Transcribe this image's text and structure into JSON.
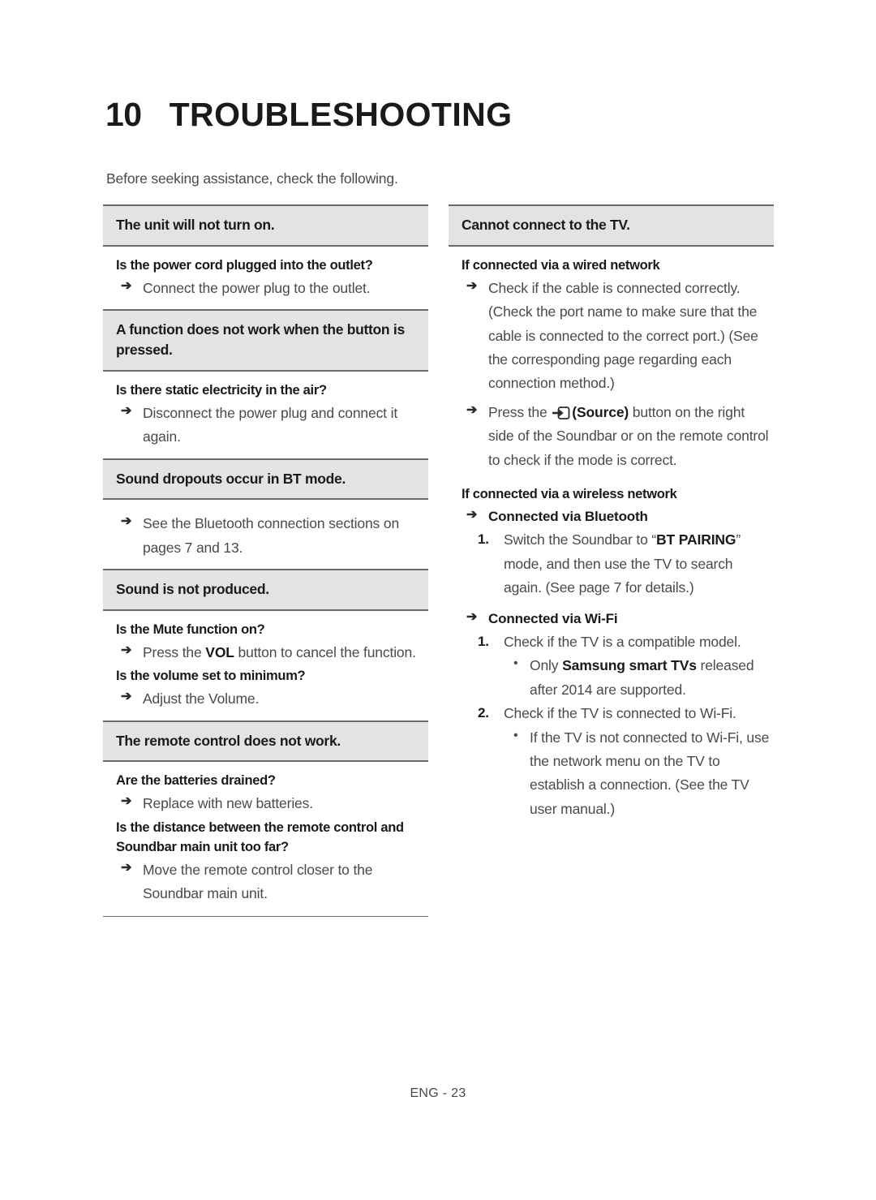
{
  "page": {
    "chapter_number": "10",
    "chapter_title": "TROUBLESHOOTING",
    "intro": "Before seeking assistance, check the following.",
    "footer": "ENG - 23",
    "gray_bar_color": "#e3e3e3",
    "rule_color": "#6a6a6a"
  },
  "left_column": {
    "sections": [
      {
        "heading": "The unit will not turn on.",
        "question": "Is the power cord plugged into the outlet?",
        "answer": "Connect the power plug to the outlet."
      },
      {
        "heading": "A function does not work when the button is pressed.",
        "question": "Is there static electricity in the air?",
        "answer": "Disconnect the power plug and connect it again."
      },
      {
        "heading": "Sound dropouts occur in BT mode.",
        "answer": "See the Bluetooth connection sections on pages 7 and 13."
      },
      {
        "heading": "Sound is not produced.",
        "question": "Is the Mute function on?",
        "answer_pre": "Press the ",
        "answer_bold": "VOL",
        "answer_post": " button to cancel the function.",
        "question2": "Is the volume set to minimum?",
        "answer2": "Adjust the Volume."
      },
      {
        "heading": "The remote control does not work.",
        "question": "Are the batteries drained?",
        "answer": "Replace with new batteries.",
        "question2": "Is the distance between the remote control and Soundbar main unit too far?",
        "answer2": "Move the remote control closer to the Soundbar main unit."
      }
    ]
  },
  "right_column": {
    "heading": "Cannot connect to the TV.",
    "wired": {
      "label": "If connected via a wired network",
      "answer": "Check if the cable is connected correctly. (Check the port name to make sure that the cable is connected to the correct port.) (See the corresponding page regarding each connection method.)",
      "source_pre": "Press the ",
      "source_icon": "source-icon",
      "source_bold": "(Source)",
      "source_post": " button on the right side of the Soundbar or on the remote control to check if the mode is correct."
    },
    "wireless": {
      "label": "If connected via a wireless network",
      "bluetooth": {
        "label": "Connected via Bluetooth",
        "steps": [
          {
            "num": "1.",
            "pre": "Switch the Soundbar to “",
            "bold": "BT PAIRING",
            "post": "” mode, and then use the TV to search again. (See page 7 for details.)"
          }
        ]
      },
      "wifi": {
        "label": "Connected via Wi-Fi",
        "steps": [
          {
            "num": "1.",
            "text": "Check if the TV is a compatible model.",
            "bullets": [
              {
                "pre": "Only ",
                "bold": "Samsung smart TVs",
                "post": " released after 2014 are supported."
              }
            ]
          },
          {
            "num": "2.",
            "text": "Check if the TV is connected to Wi-Fi.",
            "bullets": [
              {
                "text": "If the TV is not connected to Wi-Fi, use the network menu on the TV to establish a connection. (See the TV user manual.)"
              }
            ]
          }
        ]
      }
    }
  },
  "glyphs": {
    "arrow": "➔",
    "bullet": "•"
  }
}
